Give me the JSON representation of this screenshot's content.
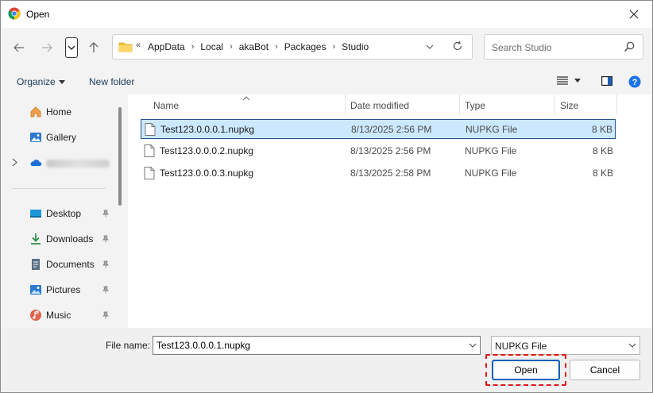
{
  "window": {
    "title": "Open"
  },
  "addressbar": {
    "overflow_chevron": "«",
    "crumbs": [
      "AppData",
      "Local",
      "akaBot",
      "Packages",
      "Studio"
    ]
  },
  "search": {
    "placeholder": "Search Studio"
  },
  "toolbar": {
    "organize_label": "Organize",
    "new_folder_label": "New folder"
  },
  "navpane": {
    "items": [
      {
        "label": "Home",
        "icon": "home-icon"
      },
      {
        "label": "Gallery",
        "icon": "gallery-icon"
      },
      {
        "label": "",
        "icon": "onedrive-icon",
        "redacted": true
      },
      {
        "label": "Desktop",
        "icon": "desktop-icon",
        "pinned": true
      },
      {
        "label": "Downloads",
        "icon": "downloads-icon",
        "pinned": true
      },
      {
        "label": "Documents",
        "icon": "documents-icon",
        "pinned": true
      },
      {
        "label": "Pictures",
        "icon": "pictures-icon",
        "pinned": true
      },
      {
        "label": "Music",
        "icon": "music-icon",
        "pinned": true
      }
    ]
  },
  "filelist": {
    "columns": [
      "Name",
      "Date modified",
      "Type",
      "Size"
    ],
    "rows": [
      {
        "name": "Test123.0.0.0.1.nupkg",
        "date": "8/13/2025 2:56 PM",
        "type": "NUPKG File",
        "size": "8 KB",
        "selected": true
      },
      {
        "name": "Test123.0.0.0.2.nupkg",
        "date": "8/13/2025 2:56 PM",
        "type": "NUPKG File",
        "size": "8 KB",
        "selected": false
      },
      {
        "name": "Test123.0.0.0.3.nupkg",
        "date": "8/13/2025 2:58 PM",
        "type": "NUPKG File",
        "size": "8 KB",
        "selected": false
      }
    ]
  },
  "bottombar": {
    "file_name_label": "File name:",
    "file_name_value": "Test123.0.0.0.1.nupkg",
    "file_type_value": "NUPKG File",
    "open_label": "Open",
    "cancel_label": "Cancel"
  },
  "colors": {
    "accent": "#005fb8",
    "selection": "#cce8ff",
    "highlight": "#e0191b"
  }
}
